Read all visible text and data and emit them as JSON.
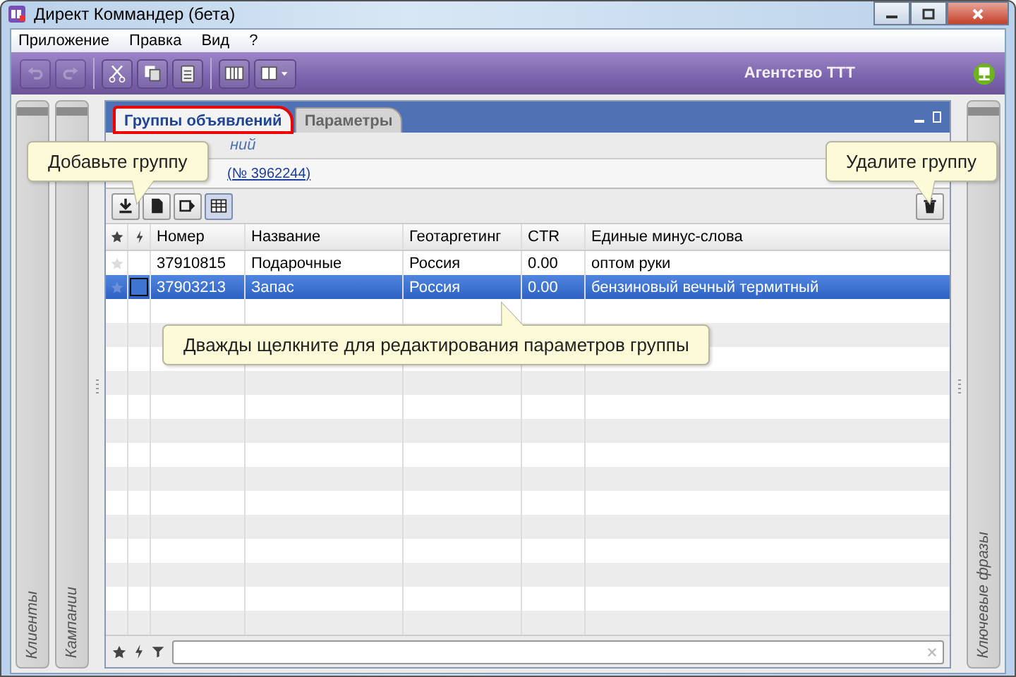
{
  "window": {
    "title": "Директ Коммандер (бета)"
  },
  "menu": [
    "Приложение",
    "Правка",
    "Вид",
    "?"
  ],
  "toolbar": {
    "account": "Агентство ТТТ"
  },
  "left_panels": [
    {
      "label": "Клиенты"
    },
    {
      "label": "Кампании"
    }
  ],
  "right_panel": {
    "label": "Ключевые фразы"
  },
  "tabs": [
    {
      "label": "Группы объявлений",
      "selected": true
    },
    {
      "label": "Параметры",
      "selected": false
    }
  ],
  "breadcrumb": {
    "text": "ний",
    "link": "(№ 3962244)"
  },
  "table": {
    "columns": [
      "Номер",
      "Название",
      "Геотаргетинг",
      "CTR",
      "Единые минус-слова"
    ],
    "rows": [
      {
        "cells": [
          "37910815",
          "Подарочные",
          "Россия",
          "0.00",
          "оптом руки"
        ],
        "selected": false
      },
      {
        "cells": [
          "37903213",
          "Запас",
          "Россия",
          "0.00",
          "бензиновый вечный термитный"
        ],
        "selected": true
      }
    ]
  },
  "tooltips": [
    {
      "text": "Добавьте группу",
      "kind": "left"
    },
    {
      "text": "Удалите группу",
      "kind": "right"
    },
    {
      "text": "Дважды щелкните для редактирования параметров группы",
      "kind": "center"
    }
  ]
}
